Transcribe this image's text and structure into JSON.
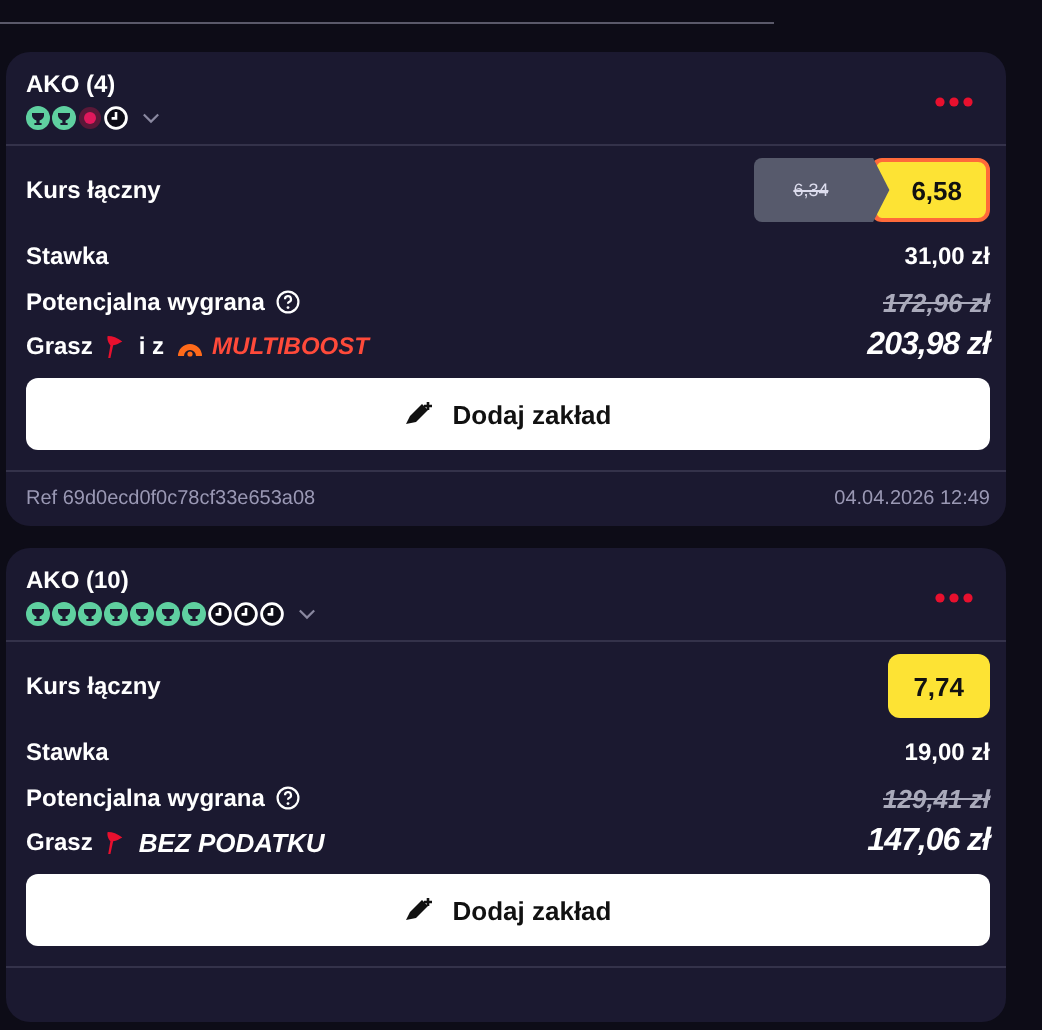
{
  "bets": [
    {
      "title": "AKO (4)",
      "legs": [
        {
          "kind": "won"
        },
        {
          "kind": "won"
        },
        {
          "kind": "lost"
        },
        {
          "kind": "pending"
        }
      ],
      "odds_label": "Kurs łączny",
      "old_odds": "6,34",
      "odds": "6,58",
      "stake_label": "Stawka",
      "stake": "31,00 zł",
      "win_label": "Potencjalna wygrana",
      "old_win": "172,96 zł",
      "win": "203,98 zł",
      "bonus_label": "Grasz",
      "bonus": [
        {
          "kind": "text",
          "text": "i z"
        },
        {
          "kind": "multiboost",
          "text": "MULTIBOOST"
        }
      ],
      "button": "Dodaj zakład",
      "ref": "Ref 69d0ecd0f0c78cf33e653a08",
      "date": "04.04.2026 12:49"
    },
    {
      "title": "AKO (10)",
      "legs": [
        {
          "kind": "won"
        },
        {
          "kind": "won"
        },
        {
          "kind": "won"
        },
        {
          "kind": "won"
        },
        {
          "kind": "won"
        },
        {
          "kind": "won"
        },
        {
          "kind": "won"
        },
        {
          "kind": "pending"
        },
        {
          "kind": "pending"
        },
        {
          "kind": "pending"
        }
      ],
      "odds_label": "Kurs łączny",
      "odds": "7,74",
      "stake_label": "Stawka",
      "stake": "19,00 zł",
      "win_label": "Potencjalna wygrana",
      "old_win": "129,41 zł",
      "win": "147,06 zł",
      "bonus_label": "Grasz",
      "bonus": [
        {
          "kind": "tax-free",
          "text": "BEZ PODATKU"
        }
      ],
      "button": "Dodaj zakład"
    }
  ]
}
